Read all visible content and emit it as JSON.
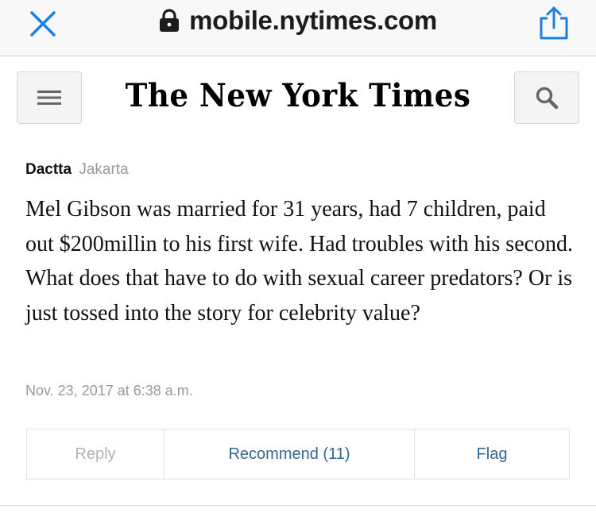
{
  "browser": {
    "url": "mobile.nytimes.com",
    "accent_color": "#1a80e5",
    "icons": {
      "close": "close-icon",
      "lock": "lock-icon",
      "share": "share-icon"
    }
  },
  "header": {
    "masthead": "The New York Times",
    "icons": {
      "menu": "hamburger-menu-icon",
      "search": "search-icon"
    }
  },
  "comment": {
    "author": "Dactta",
    "location": "Jakarta",
    "body": "Mel Gibson was married for 31 years, had 7 children, paid out $200millin to his first wife. Had troubles with his second. What does that have to do with sexual career predators? Or is just tossed into the story for celebrity value?",
    "timestamp": "Nov. 23, 2017 at 6:38 a.m."
  },
  "actions": {
    "reply_label": "Reply",
    "recommend_label": "Recommend (11)",
    "flag_label": "Flag",
    "link_color": "#326891",
    "disabled_color": "#b3b3b3"
  }
}
